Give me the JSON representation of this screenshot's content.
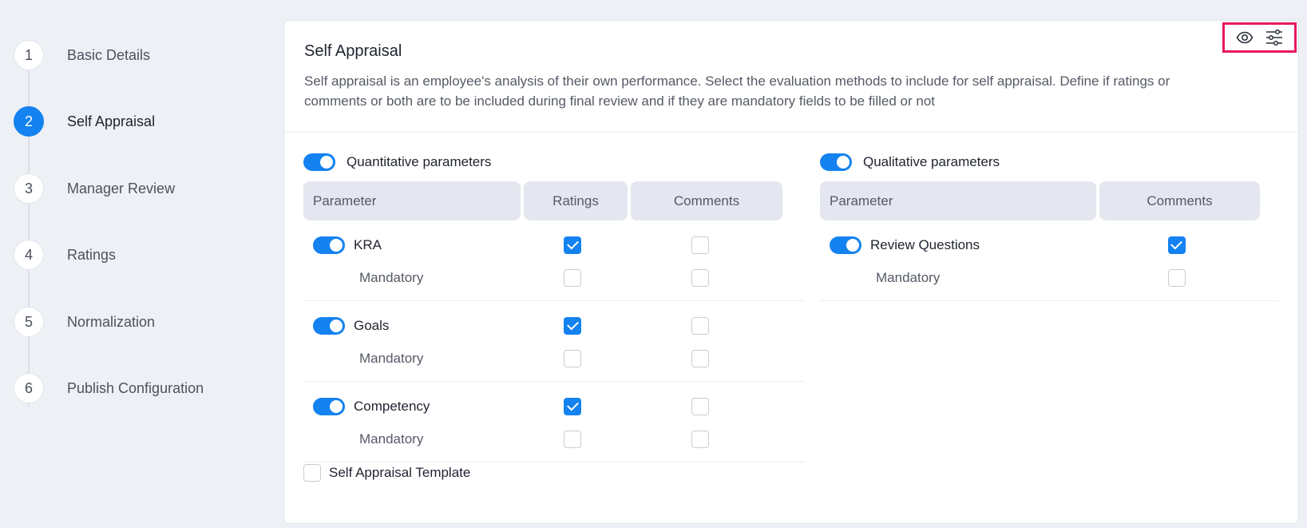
{
  "stepper": {
    "steps": [
      {
        "number": "1",
        "label": "Basic Details"
      },
      {
        "number": "2",
        "label": "Self Appraisal"
      },
      {
        "number": "3",
        "label": "Manager Review"
      },
      {
        "number": "4",
        "label": "Ratings"
      },
      {
        "number": "5",
        "label": "Normalization"
      },
      {
        "number": "6",
        "label": "Publish Configuration"
      }
    ],
    "active_step": "2"
  },
  "card": {
    "title": "Self Appraisal",
    "description": "Self appraisal is an employee's analysis of their own performance. Select the evaluation methods to include for self appraisal. Define if ratings or comments or both are to be included during final review and if they are mandatory fields to be filled or not",
    "tools": [
      "eye-icon",
      "sliders-icon"
    ],
    "highlight_color": "#e8175d"
  },
  "quantitative": {
    "label": "Quantitative parameters",
    "enabled": true,
    "headers": {
      "parameter": "Parameter",
      "ratings": "Ratings",
      "comments": "Comments"
    },
    "rows": [
      {
        "name": "KRA",
        "enabled": true,
        "ratings": true,
        "comments": false,
        "mandatory_label": "Mandatory",
        "mandatory_ratings": false,
        "mandatory_comments": false
      },
      {
        "name": "Goals",
        "enabled": true,
        "ratings": true,
        "comments": false,
        "mandatory_label": "Mandatory",
        "mandatory_ratings": false,
        "mandatory_comments": false
      },
      {
        "name": "Competency",
        "enabled": true,
        "ratings": true,
        "comments": false,
        "mandatory_label": "Mandatory",
        "mandatory_ratings": false,
        "mandatory_comments": false
      }
    ]
  },
  "qualitative": {
    "label": "Qualitative parameters",
    "enabled": true,
    "headers": {
      "parameter": "Parameter",
      "comments": "Comments"
    },
    "rows": [
      {
        "name": "Review Questions",
        "enabled": true,
        "comments": true,
        "mandatory_label": "Mandatory",
        "mandatory_comments": false
      }
    ]
  },
  "template": {
    "label": "Self Appraisal Template",
    "checked": false
  },
  "colors": {
    "accent": "#1482f0",
    "page_bg": "#edf0f5",
    "header_bg": "#e4e6f0"
  }
}
